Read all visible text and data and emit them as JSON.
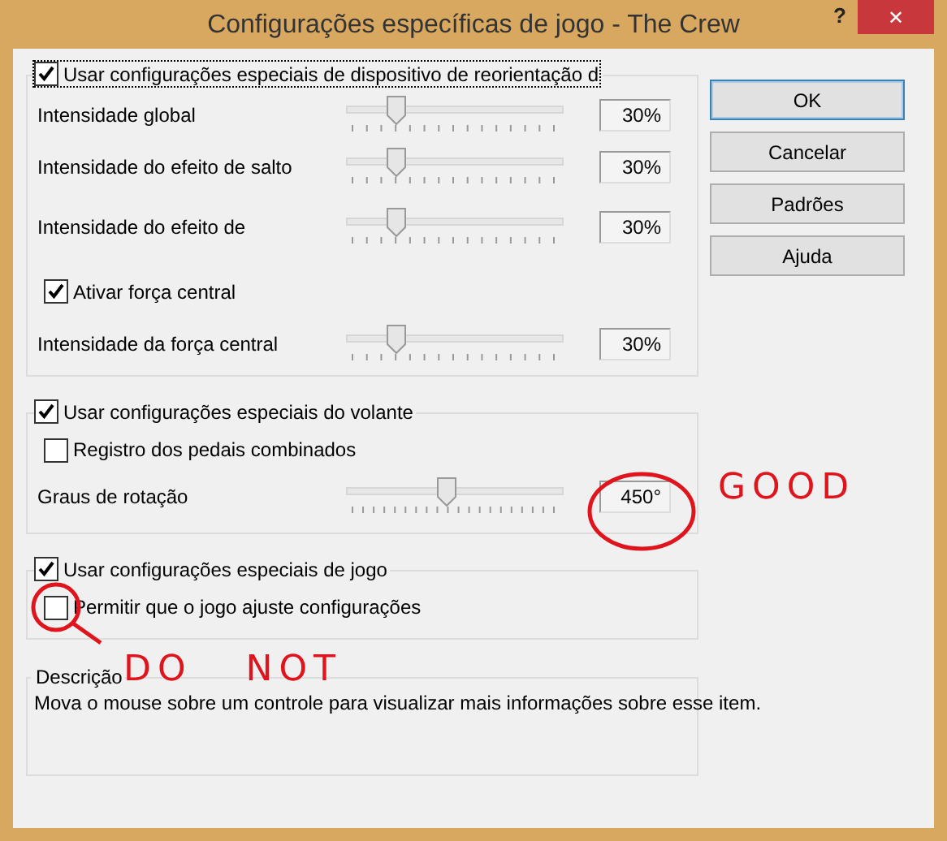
{
  "window": {
    "title": "Configurações específicas de jogo - The Crew",
    "help": "?",
    "close": "✕"
  },
  "groups": [
    {
      "header": {
        "label": "Usar configurações especiais de dispositivo de reorientação d",
        "checked": true,
        "focused": true
      },
      "rows": [
        {
          "kind": "slider",
          "label": "Intensidade global",
          "level": 0.22,
          "reading": "30%"
        },
        {
          "kind": "slider",
          "label": "Intensidade do efeito de salto",
          "level": 0.22,
          "reading": "30%"
        },
        {
          "kind": "slider",
          "label": "Intensidade do efeito de",
          "level": 0.22,
          "reading": "30%"
        },
        {
          "kind": "checkbox",
          "label": "Ativar força central",
          "checked": true
        },
        {
          "kind": "slider",
          "label": "Intensidade da força central",
          "level": 0.22,
          "reading": "30%"
        }
      ]
    },
    {
      "header": {
        "label": "Usar configurações especiais do volante",
        "checked": true,
        "focused": false
      },
      "rows": [
        {
          "kind": "checkbox",
          "label": "Registro dos pedais combinados",
          "checked": false
        },
        {
          "kind": "slider",
          "label": "Graus de rotação",
          "level": 0.47,
          "reading": "450°"
        }
      ]
    },
    {
      "header": {
        "label": "Usar configurações especiais de jogo",
        "checked": true,
        "focused": false
      },
      "rows": [
        {
          "kind": "checkbox",
          "label": "Permitir que o jogo ajuste configurações",
          "checked": false
        }
      ]
    }
  ],
  "description": {
    "title": "Descrição",
    "text": "Mova o mouse sobre um controle para visualizar mais informações sobre esse item."
  },
  "buttons": [
    {
      "label": "OK",
      "default": true
    },
    {
      "label": "Cancelar",
      "default": false
    },
    {
      "label": "Padrões",
      "default": false
    },
    {
      "label": "Ajuda",
      "default": false
    }
  ],
  "annotations": [
    {
      "text": "GOOD"
    },
    {
      "text": "DO NOT"
    }
  ]
}
